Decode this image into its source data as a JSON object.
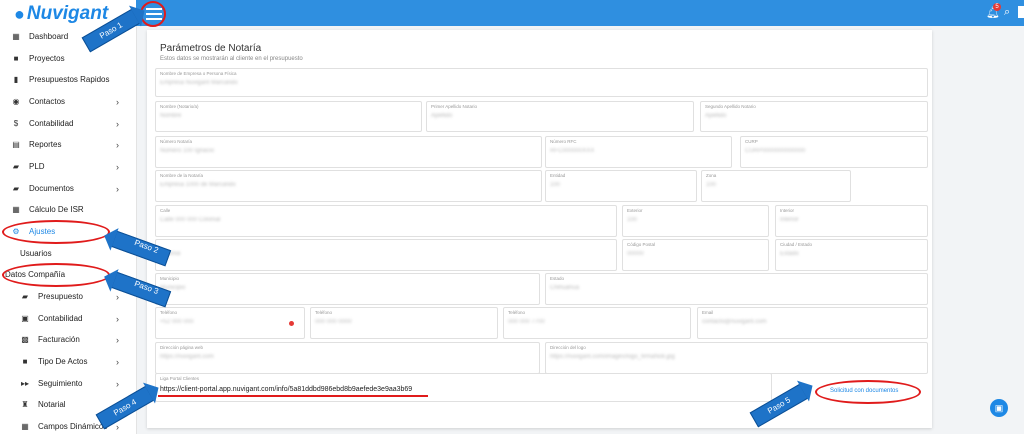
{
  "app": {
    "logo_text": "Nuvigant",
    "notification_count": "5"
  },
  "sidebar": {
    "items": [
      {
        "label": "Dashboard",
        "icon": "dashboard-icon"
      },
      {
        "label": "Proyectos",
        "icon": "briefcase-icon"
      },
      {
        "label": "Presupuestos Rapidos",
        "icon": "document-icon"
      },
      {
        "label": "Contactos",
        "icon": "person-icon"
      },
      {
        "label": "Contabilidad",
        "icon": "dollar-icon"
      },
      {
        "label": "Reportes",
        "icon": "chart-icon"
      },
      {
        "label": "PLD",
        "icon": "folder-icon"
      },
      {
        "label": "Documentos",
        "icon": "folder-icon"
      },
      {
        "label": "Cálculo De ISR",
        "icon": "calculator-icon"
      },
      {
        "label": "Ajustes",
        "icon": "gear-icon"
      },
      {
        "label": "Usuarios"
      },
      {
        "label": "Datos Compañía"
      },
      {
        "label": "Presupuesto",
        "icon": "folder-icon"
      },
      {
        "label": "Contabilidad",
        "icon": "wallet-icon"
      },
      {
        "label": "Facturación",
        "icon": "qr-icon"
      },
      {
        "label": "Tipo De Actos",
        "icon": "briefcase-icon"
      },
      {
        "label": "Seguimiento",
        "icon": "fast-forward-icon"
      },
      {
        "label": "Notarial",
        "icon": "stamp-icon"
      },
      {
        "label": "Campos Dinámicos",
        "icon": "grid-icon"
      }
    ]
  },
  "card": {
    "title": "Parámetros de Notaría",
    "subtitle": "Estos datos se mostrarán al cliente en el presupuesto",
    "fields": {
      "empresa_label": "Nombre de Empresa o Persona Física",
      "empresa_value": "Empresa  Nuvigant Marcando",
      "n1_label": "Nombre (Notario/a)",
      "n1_value": "Nombre",
      "n2_label": "Primer Apellido Notario",
      "n2_value": "Apellido",
      "n3_label": "Segundo Apellido Notario",
      "n3_value": "Apellido",
      "num_label": "Número Notaría",
      "num_value": "Número 100 Ignacio",
      "rfc_label": "Número RFC",
      "rfc_value": "RFC000000XXX",
      "curp_label": "CURP",
      "curp_value": "CURP0000000000000",
      "nom_label": "Nombre de la Notaría",
      "nom_value": "Empresa 1000 de Marcando",
      "ent_label": "Entidad",
      "ent_value": "100",
      "zona_label": "Zona",
      "zona_value": "100",
      "calle_label": "Calle",
      "calle_value": "Calle 000 000 Colonial",
      "ext_label": "Exterior",
      "ext_value": "100",
      "int_label": "Interior",
      "int_value": "Interior",
      "col_value": "Colonia",
      "cp_label": "Código Postal",
      "cp_value": "00000",
      "ciudad_label": "Ciudad / Estado",
      "ciudad_value": "Estado",
      "mun_label": "Municipio",
      "mun_value": "Municipio",
      "estado_label": "Estado",
      "estado_value": "Chihuahua",
      "tel_label": "Teléfono",
      "tel_value": "+52 000 000",
      "tel2_label": "Teléfono",
      "tel2_value": "000 000 0000",
      "tel3_label": "Teléfono",
      "tel3_value": "000 000 7700",
      "email_label": "Email",
      "email_value": "contacto@nuvigant.com",
      "web_label": "Dirección página web",
      "web_value": "https://nuvigant.com",
      "logo_label": "Dirección del logo",
      "logo_value": "https://nuvigant.com/images/logo_firmaNoti.jpg",
      "portal_label": "Liga Portal Clientes",
      "portal_value": "https://client-portal.app.nuvigant.com/info/5a81ddbd986ebd8b9aefede3e9aa3b69",
      "solicitud_label": "Solicitud con documentos"
    }
  },
  "annotations": {
    "paso1": "Paso 1",
    "paso2": "Paso 2",
    "paso3": "Paso 3",
    "paso4": "Paso 4",
    "paso5": "Paso 5"
  }
}
